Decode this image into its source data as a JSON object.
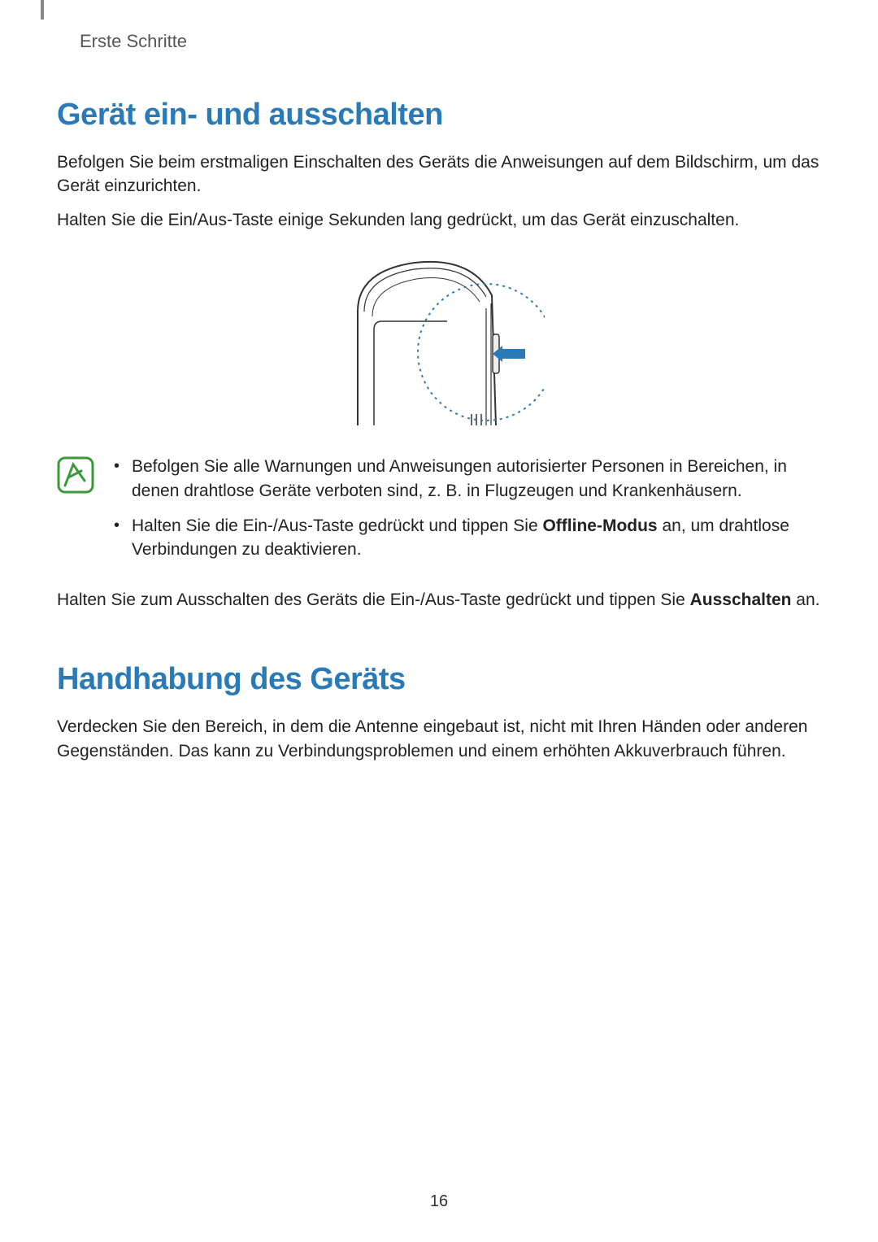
{
  "header": {
    "section": "Erste Schritte"
  },
  "section1": {
    "title": "Gerät ein- und ausschalten",
    "para1": "Befolgen Sie beim erstmaligen Einschalten des Geräts die Anweisungen auf dem Bildschirm, um das Gerät einzurichten.",
    "para2": "Halten Sie die Ein/Aus-Taste einige Sekunden lang gedrückt, um das Gerät einzuschalten.",
    "notes": {
      "item1": "Befolgen Sie alle Warnungen und Anweisungen autorisierter Personen in Bereichen, in denen drahtlose Geräte verboten sind, z. B. in Flugzeugen und Krankenhäusern.",
      "item2_prefix": "Halten Sie die Ein-/Aus-Taste gedrückt und tippen Sie ",
      "item2_bold": "Offline-Modus",
      "item2_suffix": " an, um drahtlose Verbindungen zu deaktivieren."
    },
    "para3_prefix": "Halten Sie zum Ausschalten des Geräts die Ein-/Aus-Taste gedrückt und tippen Sie ",
    "para3_bold": "Ausschalten",
    "para3_suffix": " an."
  },
  "section2": {
    "title": "Handhabung des Geräts",
    "para1": "Verdecken Sie den Bereich, in dem die Antenne eingebaut ist, nicht mit Ihren Händen oder anderen Gegenständen. Das kann zu Verbindungsproblemen und einem erhöhten Akkuverbrauch führen."
  },
  "page_number": "16"
}
